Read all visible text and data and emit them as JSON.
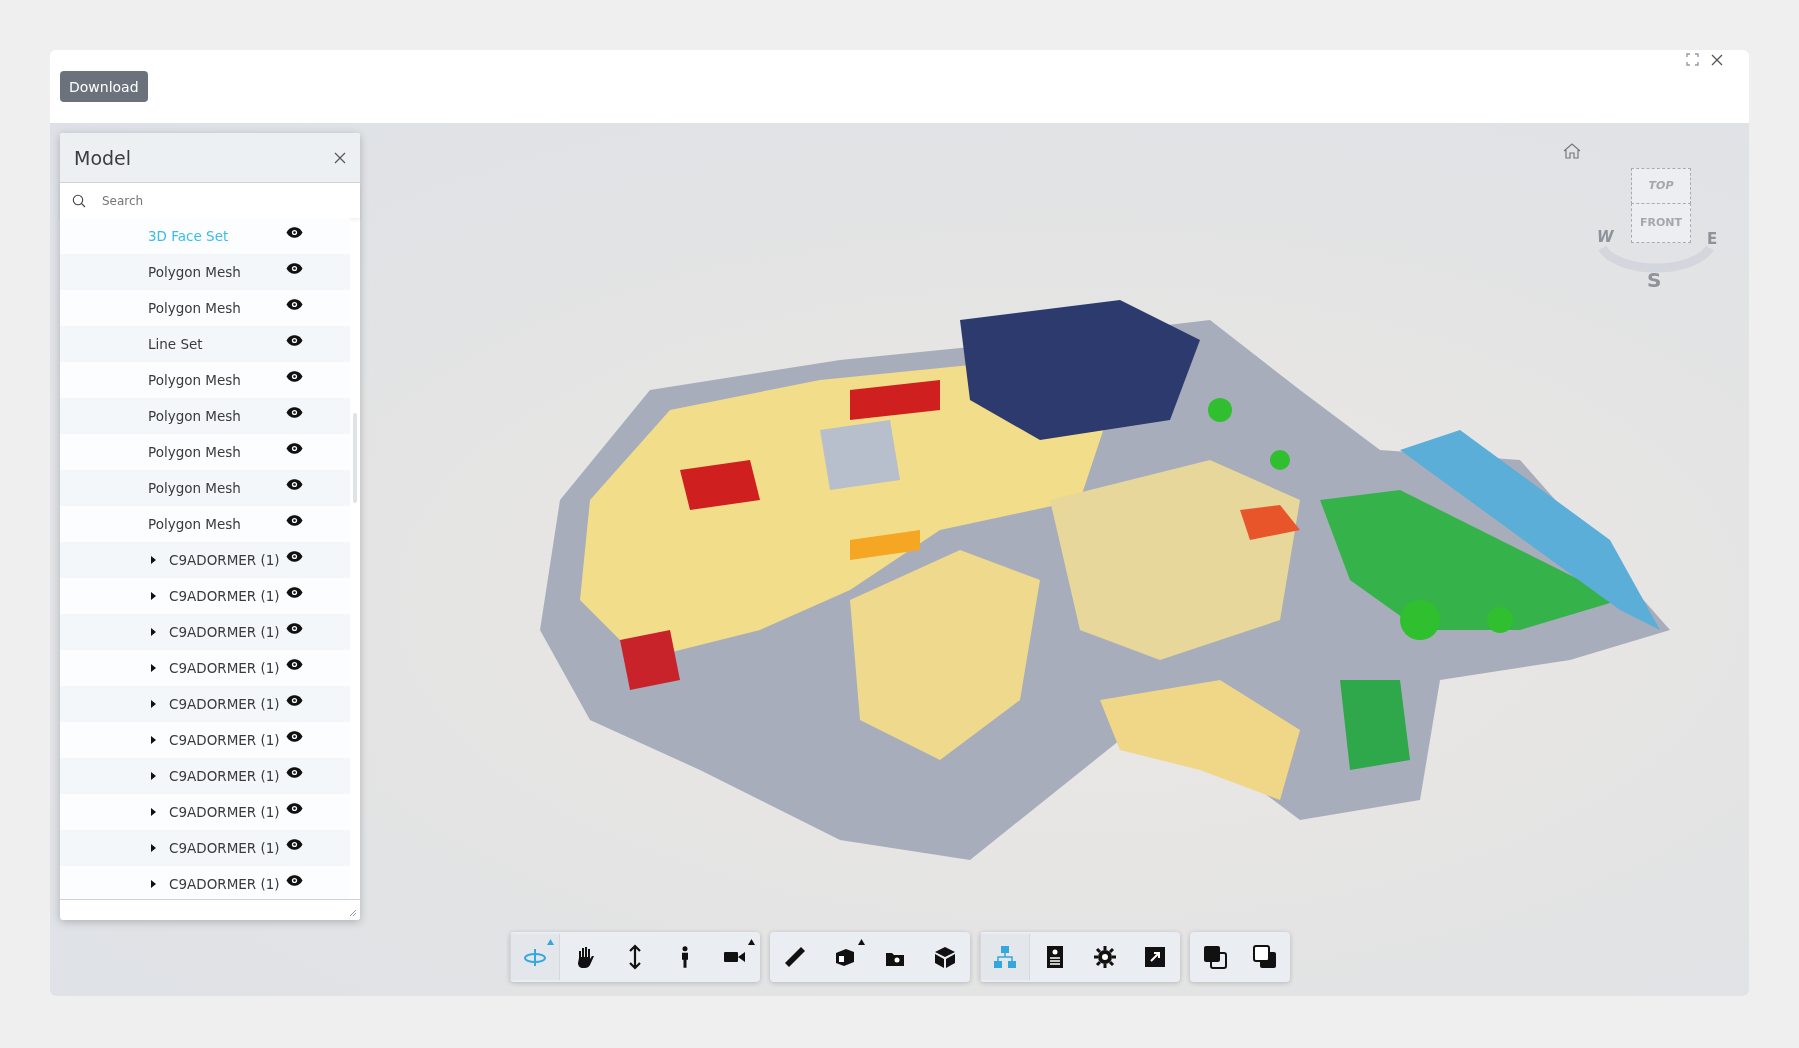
{
  "header": {
    "download_button": "Download"
  },
  "model_panel": {
    "title": "Model",
    "search": {
      "placeholder": "Search"
    },
    "rows": [
      {
        "kind": "leaf",
        "label": "3D Face Set",
        "selected": true,
        "visible": true
      },
      {
        "kind": "leaf",
        "label": "Polygon Mesh",
        "selected": false,
        "visible": true
      },
      {
        "kind": "leaf",
        "label": "Polygon Mesh",
        "selected": false,
        "visible": true
      },
      {
        "kind": "leaf",
        "label": "Line Set",
        "selected": false,
        "visible": true
      },
      {
        "kind": "leaf",
        "label": "Polygon Mesh",
        "selected": false,
        "visible": true
      },
      {
        "kind": "leaf",
        "label": "Polygon Mesh",
        "selected": false,
        "visible": true
      },
      {
        "kind": "leaf",
        "label": "Polygon Mesh",
        "selected": false,
        "visible": true
      },
      {
        "kind": "leaf",
        "label": "Polygon Mesh",
        "selected": false,
        "visible": true
      },
      {
        "kind": "leaf",
        "label": "Polygon Mesh",
        "selected": false,
        "visible": true
      },
      {
        "kind": "group",
        "label": "C9ADORMER (1)",
        "selected": false,
        "visible": true,
        "expanded": false
      },
      {
        "kind": "group",
        "label": "C9ADORMER (1)",
        "selected": false,
        "visible": true,
        "expanded": false
      },
      {
        "kind": "group",
        "label": "C9ADORMER (1)",
        "selected": false,
        "visible": true,
        "expanded": false
      },
      {
        "kind": "group",
        "label": "C9ADORMER (1)",
        "selected": false,
        "visible": true,
        "expanded": false
      },
      {
        "kind": "group",
        "label": "C9ADORMER (1)",
        "selected": false,
        "visible": true,
        "expanded": false
      },
      {
        "kind": "group",
        "label": "C9ADORMER (1)",
        "selected": false,
        "visible": true,
        "expanded": false
      },
      {
        "kind": "group",
        "label": "C9ADORMER (1)",
        "selected": false,
        "visible": true,
        "expanded": false
      },
      {
        "kind": "group",
        "label": "C9ADORMER (1)",
        "selected": false,
        "visible": true,
        "expanded": false
      },
      {
        "kind": "group",
        "label": "C9ADORMER (1)",
        "selected": false,
        "visible": true,
        "expanded": false
      },
      {
        "kind": "group",
        "label": "C9ADORMER (1)",
        "selected": false,
        "visible": true,
        "expanded": false
      }
    ]
  },
  "view_cube": {
    "top": "TOP",
    "front": "FRONT",
    "west": "W",
    "east": "E",
    "south": "S"
  },
  "toolbar": {
    "groups": [
      {
        "tools": [
          {
            "selected": true,
            "has_menu": true
          },
          {
            "selected": false,
            "has_menu": false
          },
          {
            "selected": false,
            "has_menu": false
          },
          {
            "selected": false,
            "has_menu": false
          },
          {
            "selected": false,
            "has_menu": true
          }
        ]
      },
      {
        "tools": [
          {
            "selected": false,
            "has_menu": false
          },
          {
            "selected": false,
            "has_menu": true
          },
          {
            "selected": false,
            "has_menu": false
          },
          {
            "selected": false,
            "has_menu": false
          }
        ]
      },
      {
        "tools": [
          {
            "selected": true,
            "has_menu": false
          },
          {
            "selected": false,
            "has_menu": false
          },
          {
            "selected": false,
            "has_menu": false
          },
          {
            "selected": false,
            "has_menu": false
          }
        ]
      },
      {
        "tools": [
          {
            "selected": false,
            "has_menu": false
          },
          {
            "selected": false,
            "has_menu": false
          }
        ]
      }
    ]
  }
}
